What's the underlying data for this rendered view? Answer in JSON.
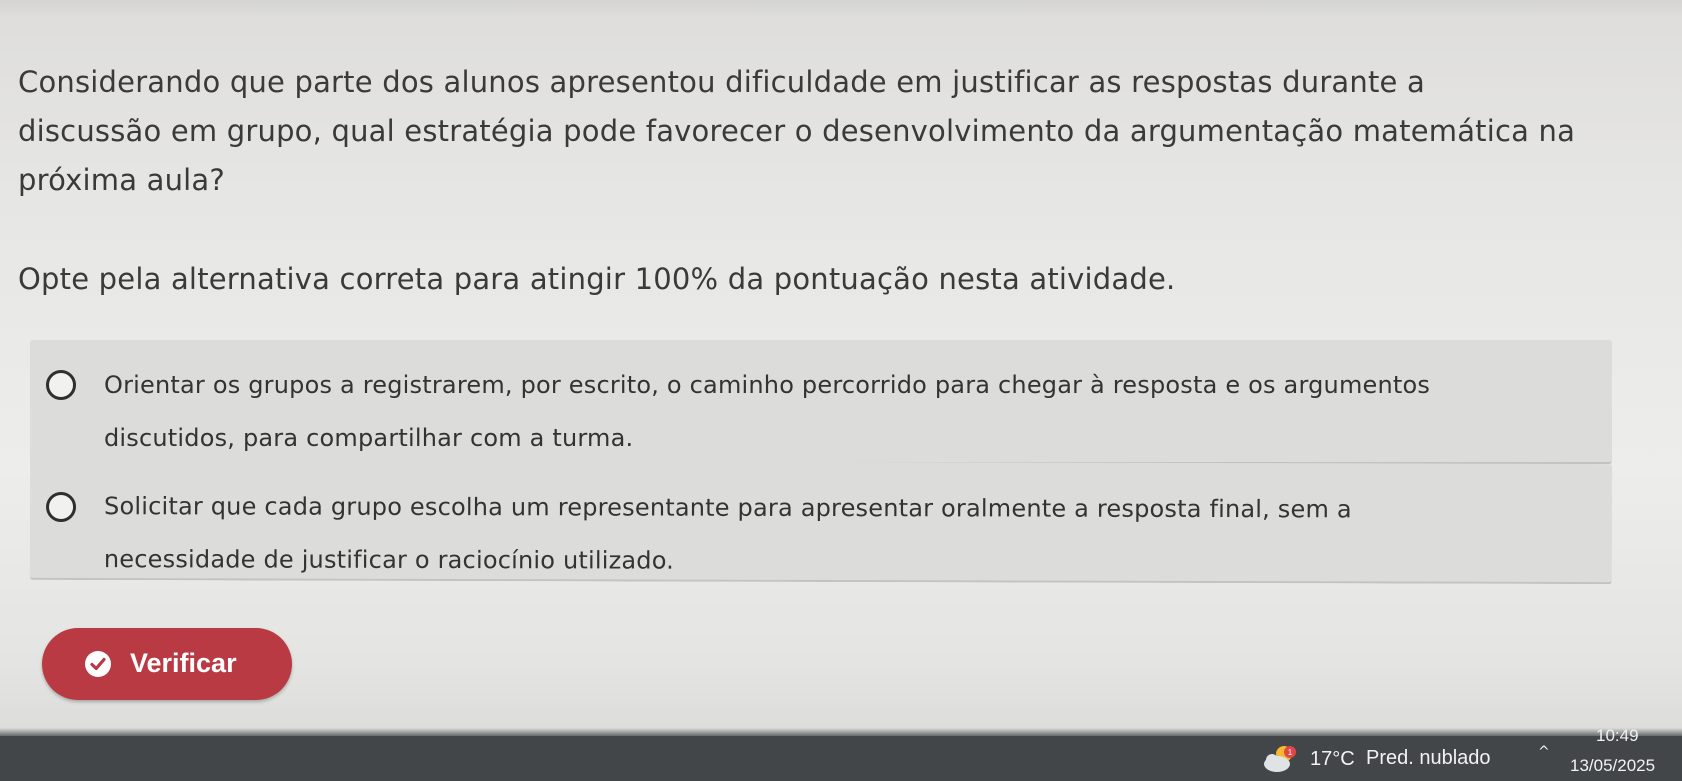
{
  "question": {
    "line1": "Considerando que parte dos alunos apresentou dificuldade em justificar as respostas durante a",
    "line2": "discussão em grupo, qual estratégia pode favorecer o desenvolvimento da argumentação matemática na",
    "line3": "próxima aula?"
  },
  "instruction": "Opte pela alternativa correta para atingir 100% da pontuação nesta atividade.",
  "options": [
    {
      "line1": "Orientar os grupos a registrarem, por escrito, o caminho percorrido para chegar à resposta e os argumentos",
      "line2": "discutidos, para compartilhar com a turma."
    },
    {
      "line1": "Solicitar que cada grupo escolha um representante para apresentar oralmente a resposta final, sem a",
      "line2": "necessidade de justificar o raciocínio utilizado."
    }
  ],
  "verify_button": {
    "label": "Verificar",
    "icon": "check-circle-icon"
  },
  "taskbar": {
    "weather_temp": "17°C",
    "weather_desc": "Pred. nublado",
    "weather_badge": "1",
    "tray_chevron": "^",
    "time": "10:49",
    "date": "13/05/2025"
  },
  "colors": {
    "button": "#b93a43",
    "option_bg": "#dcdcda",
    "taskbar": "#424648"
  }
}
